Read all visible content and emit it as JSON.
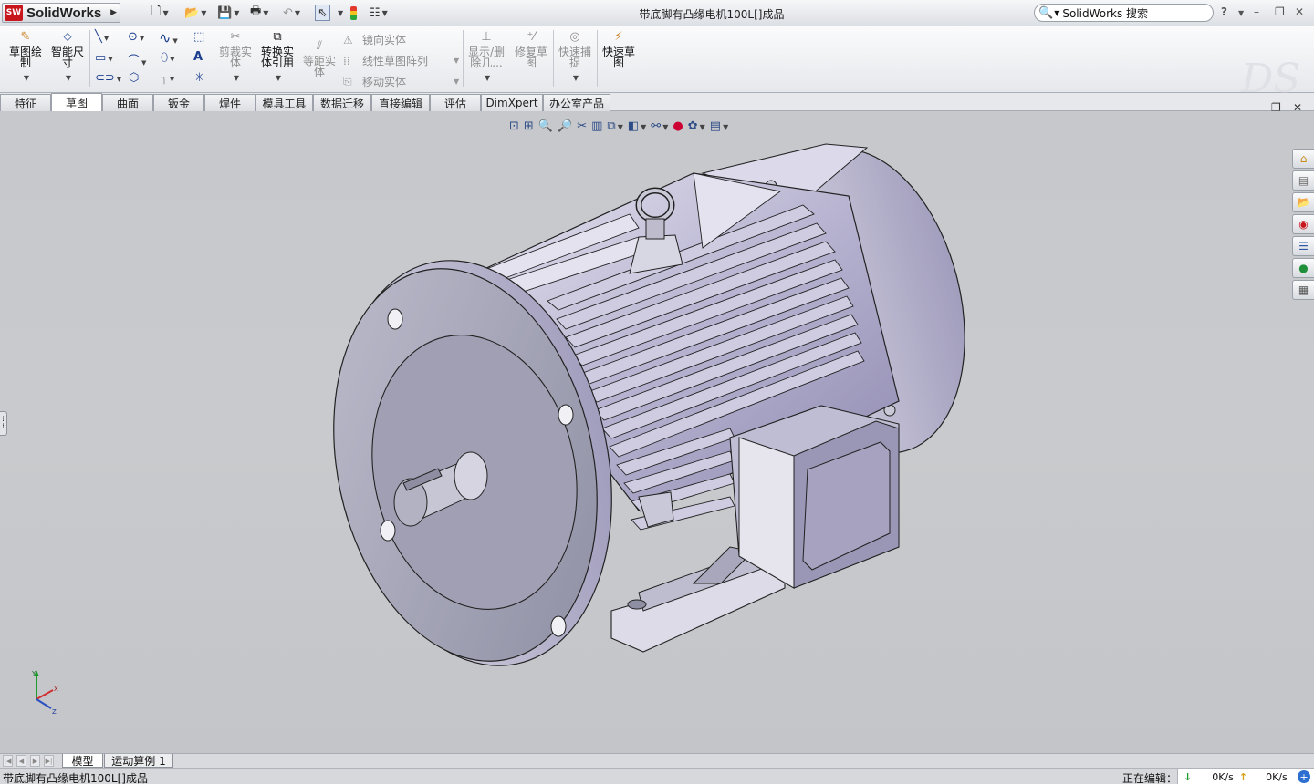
{
  "app": {
    "brand": "SolidWorks",
    "logo_letters": "SW",
    "document_title": "带底脚有凸缘电机100L[]成品"
  },
  "titlebar": {
    "quick_access": [
      "new-icon",
      "open-icon",
      "save-icon",
      "print-icon",
      "undo-icon",
      "select-icon",
      "rebuild-icon",
      "options-icon"
    ],
    "search_placeholder": "SolidWorks 搜索",
    "help_label": "?"
  },
  "commandmanager": {
    "buttons": [
      {
        "label": "草图绘\n制",
        "icon": "sketch-icon"
      },
      {
        "label": "智能尺\n寸",
        "icon": "smart-dimension-icon"
      },
      {
        "label": "剪裁实\n体",
        "icon": "trim-icon",
        "disabled": true
      },
      {
        "label": "转换实\n体引用",
        "icon": "convert-entities-icon"
      },
      {
        "label": "等距实\n体",
        "icon": "offset-icon",
        "disabled": true
      },
      {
        "label": "显示/删\n除几...",
        "icon": "display-relations-icon",
        "disabled": true
      },
      {
        "label": "修复草\n图",
        "icon": "repair-sketch-icon",
        "disabled": true
      },
      {
        "label": "快速捕\n捉",
        "icon": "quick-snaps-icon",
        "disabled": true
      },
      {
        "label": "快速草\n图",
        "icon": "rapid-sketch-icon"
      }
    ],
    "list_items": [
      "镜向实体",
      "线性草图阵列",
      "移动实体"
    ]
  },
  "tabs": [
    "特征",
    "草图",
    "曲面",
    "钣金",
    "焊件",
    "模具工具",
    "数据迁移",
    "直接编辑",
    "评估",
    "DimXpert",
    "办公室产品"
  ],
  "active_tab": "草图",
  "bottom_tabs": [
    "模型",
    "运动算例 1"
  ],
  "active_bottom_tab": "模型",
  "status": {
    "left_text": "带底脚有凸缘电机100L[]成品",
    "editing_text": "正在编辑：",
    "download_rate": "0K/s",
    "upload_rate": "0K/s"
  },
  "triad": {
    "x": "X",
    "y": "Y",
    "z": "Z"
  },
  "colors": {
    "accent": "#c8161d",
    "part": "#a9a6c8"
  }
}
